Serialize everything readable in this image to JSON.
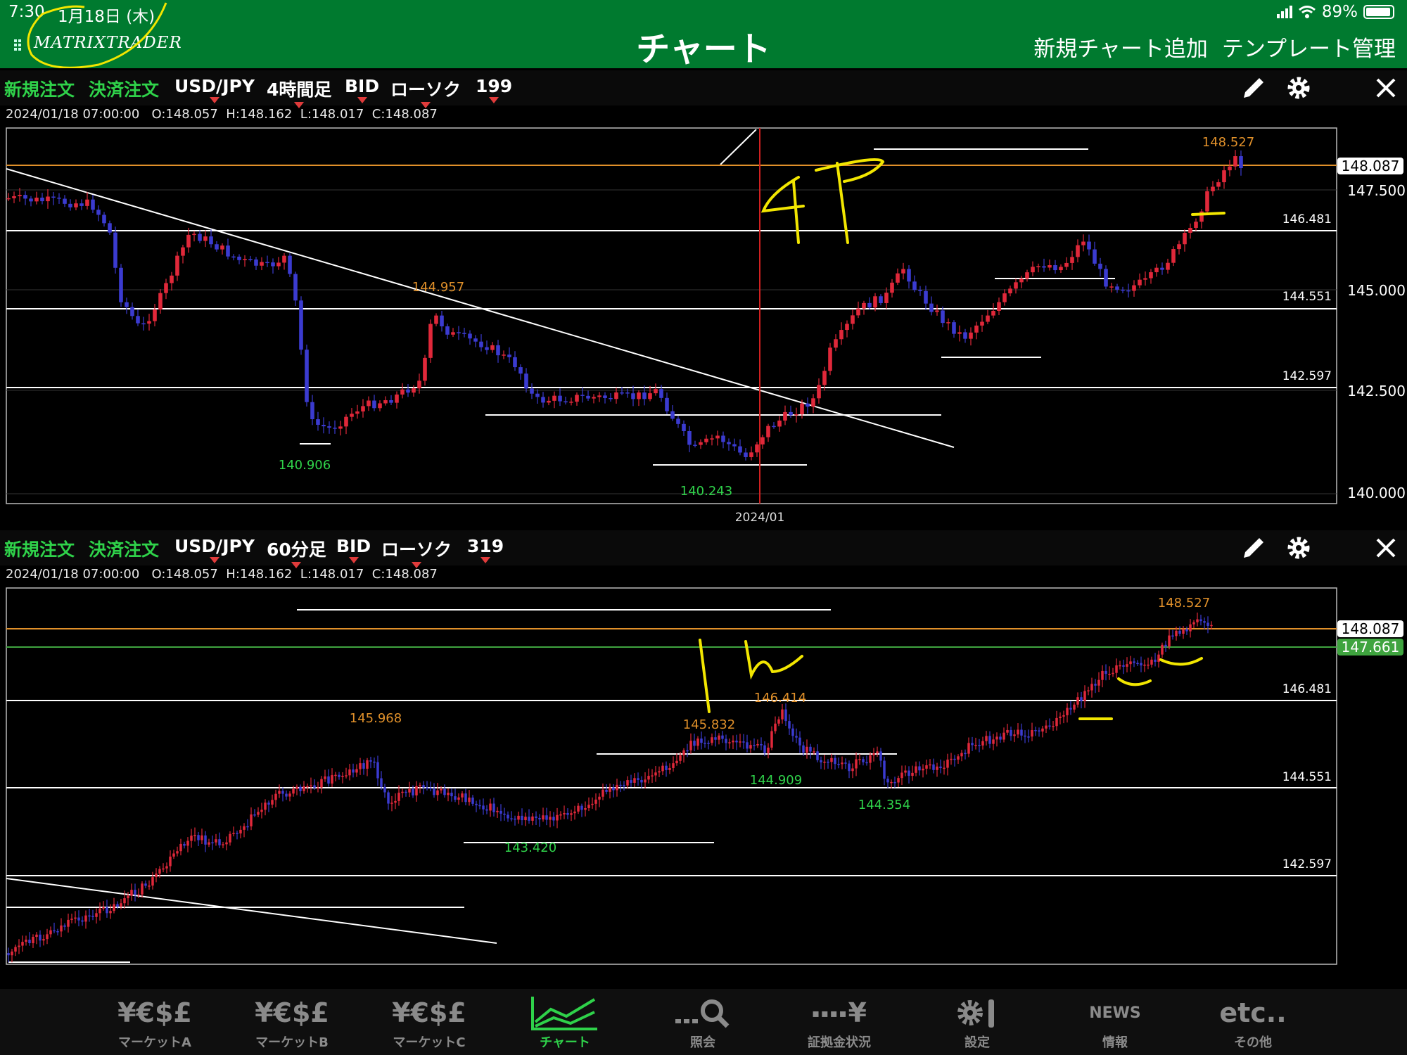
{
  "status": {
    "time": "7:30",
    "date": "1月18日 (木)",
    "battery": "89%"
  },
  "header": {
    "logo": "MATRIXTRADER",
    "title": "チャート",
    "add_chart": "新規チャート追加",
    "template": "テンプレート管理"
  },
  "charts": [
    {
      "new_order": "新規注文",
      "close_order": "決済注文",
      "pair": "USD/JPY",
      "timeframe": "4時間足",
      "price_type": "BID",
      "chart_type": "ローソク",
      "count": "199",
      "ohlc": {
        "datetime": "2024/01/18 07:00:00",
        "o": "O:148.057",
        "h": "H:148.162",
        "l": "L:148.017",
        "c": "C:148.087"
      },
      "axis_labels": [
        "147.500",
        "145.000",
        "142.500",
        "140.000"
      ],
      "current_price": "148.087",
      "level_labels": [
        "146.481",
        "144.551",
        "142.597"
      ],
      "high_marks": [
        "148.527",
        "144.957"
      ],
      "low_marks": [
        "140.906",
        "140.243"
      ],
      "date_label": "2024/01",
      "annotation": "4H"
    },
    {
      "new_order": "新規注文",
      "close_order": "決済注文",
      "pair": "USD/JPY",
      "timeframe": "60分足",
      "price_type": "BID",
      "chart_type": "ローソク",
      "count": "319",
      "ohlc": {
        "datetime": "2024/01/18 07:00:00",
        "o": "O:148.057",
        "h": "H:148.162",
        "l": "L:148.017",
        "c": "C:148.087"
      },
      "current_price": "148.087",
      "secondary_price": "147.661",
      "level_labels": [
        "146.481",
        "144.551",
        "142.597"
      ],
      "high_marks": [
        "148.527",
        "146.414",
        "145.968",
        "145.832"
      ],
      "low_marks": [
        "144.909",
        "144.354",
        "143.420"
      ],
      "annotation": "1h"
    }
  ],
  "tabs": [
    {
      "icon": "¥€$£",
      "label": "マーケットA",
      "icon_name": "currency-icon"
    },
    {
      "icon": "¥€$£",
      "label": "マーケットB",
      "icon_name": "currency-icon"
    },
    {
      "icon": "¥€$£",
      "label": "マーケットC",
      "icon_name": "currency-icon"
    },
    {
      "icon": "",
      "label": "チャート",
      "icon_name": "chart-icon",
      "active": true
    },
    {
      "icon": "",
      "label": "照会",
      "icon_name": "search-icon"
    },
    {
      "icon": "¥",
      "label": "証拠金状況",
      "icon_name": "margin-icon"
    },
    {
      "icon": "",
      "label": "設定",
      "icon_name": "settings-icon"
    },
    {
      "icon": "NEWS",
      "label": "情報",
      "icon_name": "news-icon"
    },
    {
      "icon": "etc..",
      "label": "その他",
      "icon_name": "more-icon"
    }
  ],
  "colors": {
    "header_green": "#007a2f",
    "bull": "#e0283a",
    "bear": "#3b3bd0",
    "price_line": "#e0902a",
    "green_text": "#2fd24a"
  }
}
